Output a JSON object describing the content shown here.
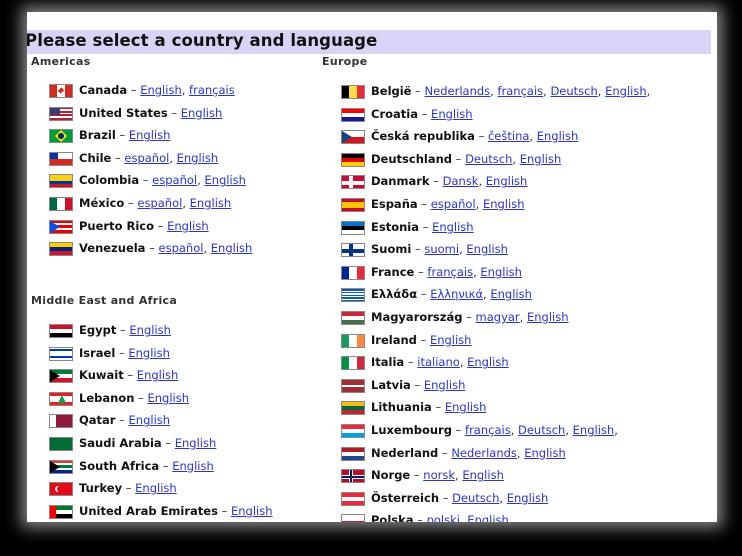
{
  "title": "Please select a country and language",
  "sections": {
    "americas": "Americas",
    "mea": "Middle East and Africa",
    "europe": "Europe"
  },
  "separator": "–",
  "americas": [
    {
      "country": "Canada",
      "langs": [
        "English",
        "français"
      ],
      "flag": {
        "type": "v",
        "colors": [
          "#d52b1e",
          "#ffffff",
          "#d52b1e"
        ],
        "emblem": "maple-leaf"
      }
    },
    {
      "country": "United States",
      "langs": [
        "English"
      ],
      "flag": {
        "type": "us",
        "colors": [
          "#b22234",
          "#ffffff",
          "#3c3b6e"
        ]
      }
    },
    {
      "country": "Brazil",
      "langs": [
        "English"
      ],
      "flag": {
        "type": "brazil",
        "colors": [
          "#009c3b",
          "#ffdf00",
          "#002776"
        ]
      }
    },
    {
      "country": "Chile",
      "langs": [
        "español",
        "English"
      ],
      "flag": {
        "type": "h",
        "colors": [
          "#ffffff",
          "#d52b1e"
        ],
        "canton": "#0039a6"
      }
    },
    {
      "country": "Colombia",
      "langs": [
        "español",
        "English"
      ],
      "flag": {
        "type": "h",
        "colors": [
          "#fcd116",
          "#fcd116",
          "#003893",
          "#ce1126"
        ]
      }
    },
    {
      "country": "México",
      "langs": [
        "español",
        "English"
      ],
      "flag": {
        "type": "v",
        "colors": [
          "#006847",
          "#ffffff",
          "#ce1126"
        ]
      }
    },
    {
      "country": "Puerto Rico",
      "langs": [
        "English"
      ],
      "flag": {
        "type": "h",
        "colors": [
          "#ed0000",
          "#ffffff",
          "#ed0000",
          "#ffffff",
          "#ed0000"
        ],
        "triangle": "#0050f0"
      }
    },
    {
      "country": "Venezuela",
      "langs": [
        "español",
        "English"
      ],
      "flag": {
        "type": "h",
        "colors": [
          "#ffcc00",
          "#00247d",
          "#cf142b"
        ]
      }
    }
  ],
  "mea": [
    {
      "country": "Egypt",
      "langs": [
        "English"
      ],
      "flag": {
        "type": "h",
        "colors": [
          "#ce1126",
          "#ffffff",
          "#000000"
        ]
      }
    },
    {
      "country": "Israel",
      "langs": [
        "English"
      ],
      "flag": {
        "type": "h",
        "colors": [
          "#ffffff",
          "#0038b8",
          "#ffffff",
          "#ffffff",
          "#ffffff",
          "#0038b8",
          "#ffffff"
        ]
      }
    },
    {
      "country": "Kuwait",
      "langs": [
        "English"
      ],
      "flag": {
        "type": "h",
        "colors": [
          "#007a3d",
          "#ffffff",
          "#ce1126"
        ],
        "triangle": "#000000"
      }
    },
    {
      "country": "Lebanon",
      "langs": [
        "English"
      ],
      "flag": {
        "type": "h",
        "colors": [
          "#ed1c24",
          "#ffffff",
          "#ffffff",
          "#ed1c24"
        ],
        "emblem": "cedar"
      }
    },
    {
      "country": "Qatar",
      "langs": [
        "English"
      ],
      "flag": {
        "type": "v",
        "colors": [
          "#ffffff",
          "#8d1b3d",
          "#8d1b3d",
          "#8d1b3d"
        ]
      }
    },
    {
      "country": "Saudi Arabia",
      "langs": [
        "English"
      ],
      "flag": {
        "type": "h",
        "colors": [
          "#006c35"
        ]
      }
    },
    {
      "country": "South Africa",
      "langs": [
        "English"
      ],
      "flag": {
        "type": "h",
        "colors": [
          "#de3831",
          "#ffffff",
          "#007a4d",
          "#ffffff",
          "#002395"
        ],
        "triangle": "#000000"
      }
    },
    {
      "country": "Turkey",
      "langs": [
        "English"
      ],
      "flag": {
        "type": "h",
        "colors": [
          "#e30a17"
        ],
        "emblem": "crescent"
      }
    },
    {
      "country": "United Arab Emirates",
      "langs": [
        "English"
      ],
      "flag": {
        "type": "h",
        "colors": [
          "#00732f",
          "#ffffff",
          "#000000"
        ],
        "hoist": "#ff0000"
      }
    }
  ],
  "europe": [
    {
      "country": "België",
      "langs": [
        "Nederlands",
        "français",
        "Deutsch",
        "English"
      ],
      "trailing": ",",
      "flag": {
        "type": "v",
        "colors": [
          "#000000",
          "#fae042",
          "#ed2939"
        ]
      }
    },
    {
      "country": "Croatia",
      "langs": [
        "English"
      ],
      "flag": {
        "type": "h",
        "colors": [
          "#ff0000",
          "#ffffff",
          "#171796"
        ]
      }
    },
    {
      "country": "Česká republika",
      "langs": [
        "čeština",
        "English"
      ],
      "flag": {
        "type": "h",
        "colors": [
          "#ffffff",
          "#d7141a"
        ],
        "triangle": "#11457e"
      }
    },
    {
      "country": "Deutschland",
      "langs": [
        "Deutsch",
        "English"
      ],
      "flag": {
        "type": "h",
        "colors": [
          "#000000",
          "#dd0000",
          "#ffce00"
        ]
      }
    },
    {
      "country": "Danmark",
      "langs": [
        "Dansk",
        "English"
      ],
      "flag": {
        "type": "cross",
        "colors": [
          "#c60c30",
          "#ffffff"
        ]
      }
    },
    {
      "country": "España",
      "langs": [
        "español",
        "English"
      ],
      "flag": {
        "type": "h",
        "colors": [
          "#c60b1e",
          "#ffc400",
          "#ffc400",
          "#c60b1e"
        ]
      }
    },
    {
      "country": "Estonia",
      "langs": [
        "English"
      ],
      "flag": {
        "type": "h",
        "colors": [
          "#0072ce",
          "#000000",
          "#ffffff"
        ]
      }
    },
    {
      "country": "Suomi",
      "langs": [
        "suomi",
        "English"
      ],
      "flag": {
        "type": "cross",
        "colors": [
          "#ffffff",
          "#003580"
        ]
      }
    },
    {
      "country": "France",
      "langs": [
        "français",
        "English"
      ],
      "flag": {
        "type": "v",
        "colors": [
          "#002395",
          "#ffffff",
          "#ed2939"
        ]
      }
    },
    {
      "country": "Ελλάδα",
      "langs": [
        "Ελληνικά",
        "English"
      ],
      "flag": {
        "type": "h",
        "colors": [
          "#0d5eaf",
          "#ffffff",
          "#0d5eaf",
          "#ffffff",
          "#0d5eaf",
          "#ffffff",
          "#0d5eaf",
          "#ffffff",
          "#0d5eaf"
        ]
      }
    },
    {
      "country": "Magyarország",
      "langs": [
        "magyar",
        "English"
      ],
      "flag": {
        "type": "h",
        "colors": [
          "#ce2939",
          "#ffffff",
          "#477050"
        ]
      }
    },
    {
      "country": "Ireland",
      "langs": [
        "English"
      ],
      "flag": {
        "type": "v",
        "colors": [
          "#169b62",
          "#ffffff",
          "#ff883e"
        ]
      }
    },
    {
      "country": "Italia",
      "langs": [
        "italiano",
        "English"
      ],
      "flag": {
        "type": "v",
        "colors": [
          "#009246",
          "#ffffff",
          "#ce2b37"
        ]
      }
    },
    {
      "country": "Latvia",
      "langs": [
        "English"
      ],
      "flag": {
        "type": "h",
        "colors": [
          "#9e3039",
          "#9e3039",
          "#ffffff",
          "#9e3039",
          "#9e3039"
        ]
      }
    },
    {
      "country": "Lithuania",
      "langs": [
        "English"
      ],
      "flag": {
        "type": "h",
        "colors": [
          "#fdb913",
          "#006a44",
          "#c1272d"
        ]
      }
    },
    {
      "country": "Luxembourg",
      "langs": [
        "français",
        "Deutsch",
        "English"
      ],
      "trailing": ",",
      "flag": {
        "type": "h",
        "colors": [
          "#ed2939",
          "#ffffff",
          "#00a1de"
        ]
      }
    },
    {
      "country": "Nederland",
      "langs": [
        "Nederlands",
        "English"
      ],
      "flag": {
        "type": "h",
        "colors": [
          "#ae1c28",
          "#ffffff",
          "#21468b"
        ]
      }
    },
    {
      "country": "Norge",
      "langs": [
        "norsk",
        "English"
      ],
      "flag": {
        "type": "cross",
        "colors": [
          "#ba0c2f",
          "#ffffff"
        ],
        "inner": "#00205b"
      }
    },
    {
      "country": "Österreich",
      "langs": [
        "Deutsch",
        "English"
      ],
      "flag": {
        "type": "h",
        "colors": [
          "#ed2939",
          "#ffffff",
          "#ed2939"
        ]
      }
    },
    {
      "country": "Polska",
      "langs": [
        "polski",
        "English"
      ],
      "flag": {
        "type": "h",
        "colors": [
          "#ffffff",
          "#dc143c"
        ]
      }
    }
  ]
}
